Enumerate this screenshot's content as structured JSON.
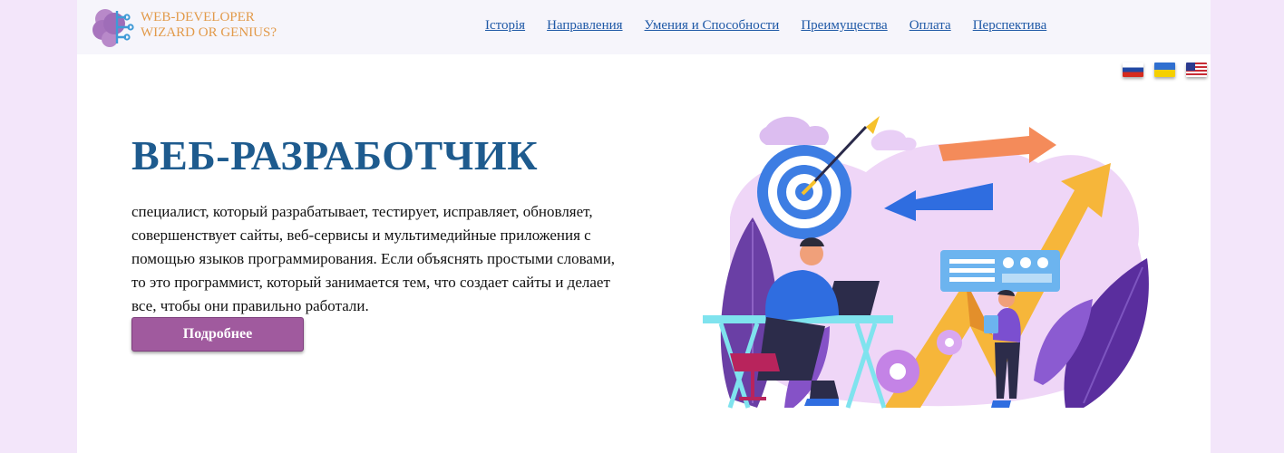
{
  "brand": {
    "line1": "WEB-DEVELOPER",
    "line2": "WIZARD OR GENIUS?"
  },
  "nav": [
    "Історія",
    "Направления",
    "Умения и Способности",
    "Преимущества",
    "Оплата",
    "Перспектива"
  ],
  "flags": [
    "russia-flag",
    "ukraine-flag",
    "usa-flag"
  ],
  "hero": {
    "title": "ВЕБ-РАЗРАБОТЧИК",
    "description": "специалист, который разрабатывает, тестирует, исправляет, обновляет, совершенствует сайты, веб-сервисы и мультимедийные приложения с помощью языков программирования. Если объяснять простыми словами, то это программист, который занимается тем, что создает сайты и делает все, чтобы они правильно работали.",
    "button": "Подробнее"
  },
  "colors": {
    "background": "#f3e6fa",
    "topbar": "#f6f5fb",
    "brand": "#e29a4a",
    "nav_link": "#1e58a6",
    "title": "#1e5b8e",
    "button": "#a05a9e"
  }
}
